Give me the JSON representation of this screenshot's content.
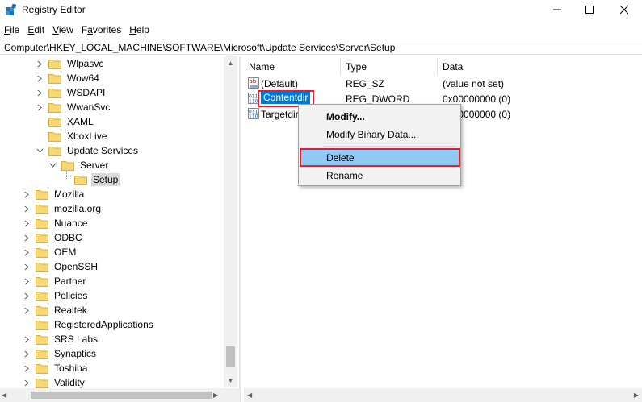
{
  "window": {
    "title": "Registry Editor",
    "controls": {
      "minimize": "–",
      "maximize": "☐",
      "close": "✕"
    }
  },
  "menu": [
    {
      "accel": "F",
      "rest": "ile"
    },
    {
      "accel": "E",
      "rest": "dit"
    },
    {
      "accel": "V",
      "rest": "iew"
    },
    {
      "accel": "F",
      "rest": "a"
    },
    {
      "accel": "H",
      "rest": "elp"
    }
  ],
  "menu_full": [
    "File",
    "Edit",
    "View",
    "Favorites",
    "Help"
  ],
  "address": "Computer\\HKEY_LOCAL_MACHINE\\SOFTWARE\\Microsoft\\Update Services\\Server\\Setup",
  "tree": [
    {
      "label": "Wlpasvc",
      "chev": "›"
    },
    {
      "label": "Wow64",
      "chev": "›"
    },
    {
      "label": "WSDAPI",
      "chev": "›"
    },
    {
      "label": "WwanSvc",
      "chev": "›"
    },
    {
      "label": "XAML",
      "chev": ""
    },
    {
      "label": "XboxLive",
      "chev": ""
    },
    {
      "label": "Update Services",
      "chev": "⌄"
    },
    {
      "label": "Server",
      "chev": "⌄"
    },
    {
      "label": "Setup",
      "chev": ""
    },
    {
      "label": "Mozilla",
      "chev": "›"
    },
    {
      "label": "mozilla.org",
      "chev": "›"
    },
    {
      "label": "Nuance",
      "chev": "›"
    },
    {
      "label": "ODBC",
      "chev": "›"
    },
    {
      "label": "OEM",
      "chev": "›"
    },
    {
      "label": "OpenSSH",
      "chev": "›"
    },
    {
      "label": "Partner",
      "chev": "›"
    },
    {
      "label": "Policies",
      "chev": "›"
    },
    {
      "label": "Realtek",
      "chev": "›"
    },
    {
      "label": "RegisteredApplications",
      "chev": ""
    },
    {
      "label": "SRS Labs",
      "chev": "›"
    },
    {
      "label": "Synaptics",
      "chev": "›"
    },
    {
      "label": "Toshiba",
      "chev": "›"
    },
    {
      "label": "Validity",
      "chev": "›"
    }
  ],
  "columns": {
    "name": "Name",
    "type": "Type",
    "data": "Data"
  },
  "values": [
    {
      "icon": "ab",
      "name": "(Default)",
      "type": "REG_SZ",
      "data": "(value not set)"
    },
    {
      "icon": "011",
      "name": "Contentdir",
      "type": "REG_DWORD",
      "data": "0x00000000 (0)"
    },
    {
      "icon": "011",
      "name": "Targetdir",
      "type": "",
      "data": "0x00000000 (0)"
    }
  ],
  "context_menu": {
    "modify": "Modify...",
    "modify_binary": "Modify Binary Data...",
    "delete": "Delete",
    "rename": "Rename"
  },
  "colors": {
    "selection_blue": "#0078d7",
    "highlight_red": "#e0202d",
    "menu_hover": "#91c9f7",
    "folder_yellow": "#f8d775"
  }
}
